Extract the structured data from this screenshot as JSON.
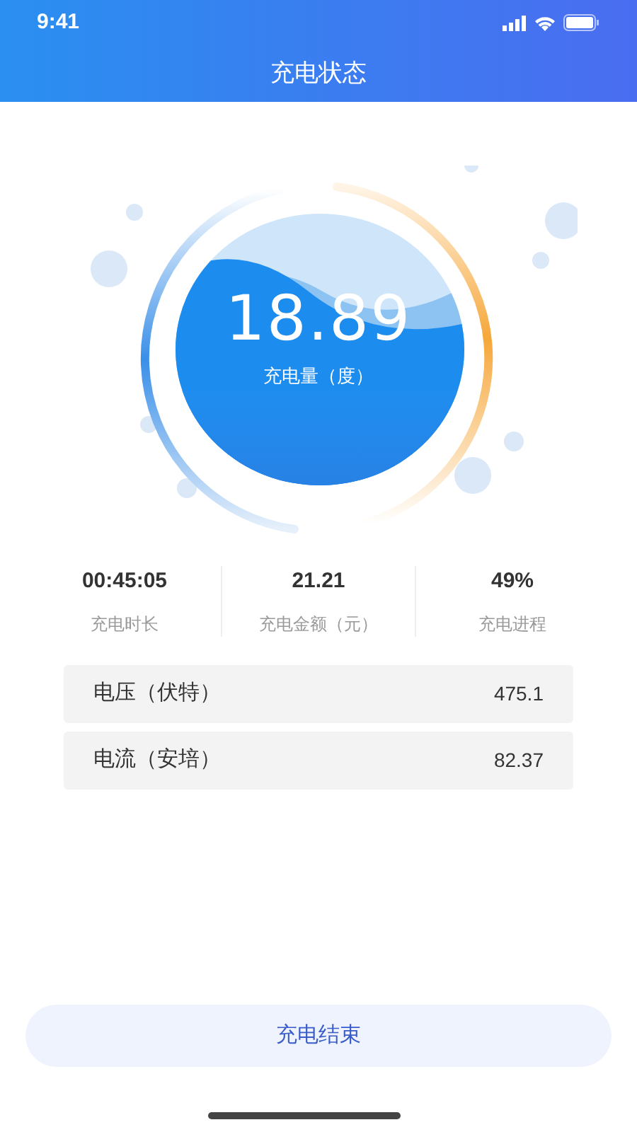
{
  "status_bar": {
    "time": "9:41"
  },
  "header": {
    "title": "充电状态"
  },
  "gauge": {
    "value": "18.89",
    "label": "充电量（度）"
  },
  "stats": [
    {
      "value": "00:45:05",
      "label": "充电时长"
    },
    {
      "value": "21.21",
      "label": "充电金额（元）"
    },
    {
      "value": "49%",
      "label": "充电进程"
    }
  ],
  "readings": [
    {
      "label": "电压（伏特）",
      "value": "475.1"
    },
    {
      "label": "电流（安培）",
      "value": "82.37"
    }
  ],
  "end_button": {
    "label": "充电结束"
  }
}
